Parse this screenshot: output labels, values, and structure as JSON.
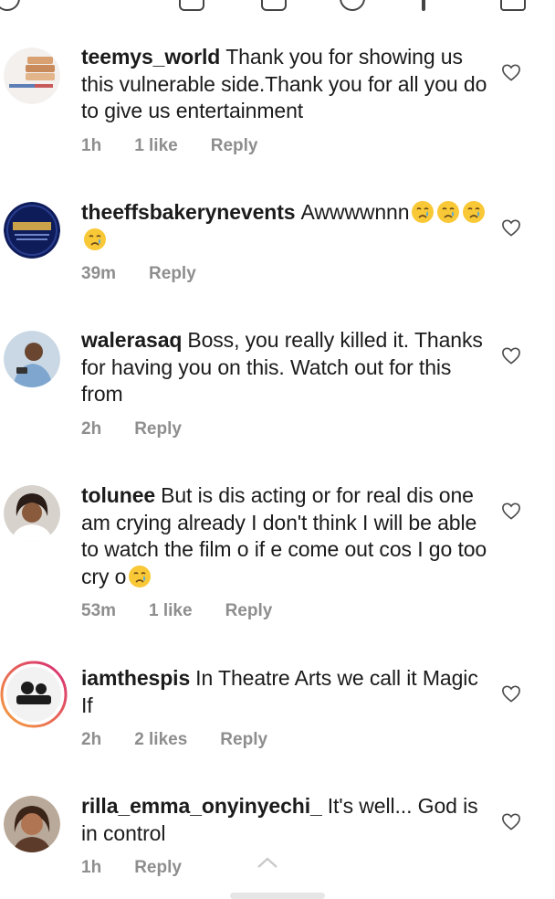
{
  "top_bar": {
    "icons": [
      "home-icon",
      "search-icon",
      "add-post-icon",
      "reels-icon",
      "notifications-icon",
      "edit-icon"
    ]
  },
  "comments": [
    {
      "username": "teemys_world",
      "text": "Thank you for showing us this vulnerable side.Thank you for all you do to give us entertainment",
      "time": "1h",
      "likes": "1 like",
      "reply_label": "Reply"
    },
    {
      "username": "theeffsbakerynevents",
      "text": "Awwwwnnn",
      "emoji": "crying-face-emoji",
      "time": "39m",
      "likes": "",
      "reply_label": "Reply"
    },
    {
      "username": "walerasaq",
      "text": "Boss, you really killed it. Thanks for having you on this. Watch out for this from",
      "time": "2h",
      "likes": "",
      "reply_label": "Reply"
    },
    {
      "username": "tolunee",
      "text": "But is dis acting or for real dis one am crying already I don't think I will be able to watch the film o if e come out cos I go too cry o",
      "emoji": "crying-face-emoji",
      "time": "53m",
      "likes": "1 like",
      "reply_label": "Reply"
    },
    {
      "username": "iamthespis",
      "text": "In Theatre Arts we call it Magic If",
      "time": "2h",
      "likes": "2 likes",
      "reply_label": "Reply"
    },
    {
      "username": "rilla_emma_onyinyechi_",
      "text": "It's well... God is in control",
      "time": "1h",
      "likes": "",
      "reply_label": "Reply"
    }
  ],
  "colors": {
    "meta_text": "#8e8e8e",
    "story_ring_start": "#f7a23b",
    "story_ring_end": "#d62976"
  }
}
